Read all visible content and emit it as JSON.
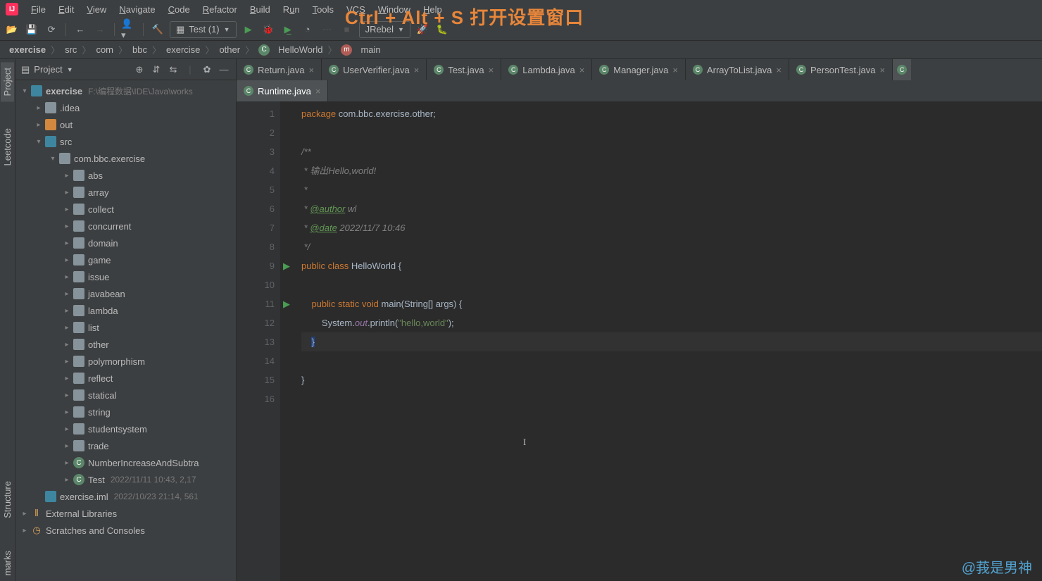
{
  "overlay_hint": "Ctrl + Alt + S 打开设置窗口",
  "menu": [
    "File",
    "Edit",
    "View",
    "Navigate",
    "Code",
    "Refactor",
    "Build",
    "Run",
    "Tools",
    "VCS",
    "Window",
    "Help"
  ],
  "toolbar": {
    "run_config": "Test (1)",
    "jrebel": "JRebel"
  },
  "breadcrumbs": [
    "exercise",
    "src",
    "com",
    "bbc",
    "exercise",
    "other",
    "HelloWorld",
    "main"
  ],
  "project_panel": {
    "title": "Project",
    "root": {
      "name": "exercise",
      "path": "F:\\编程数据\\IDE\\Java\\works"
    },
    "items": [
      {
        "level": 1,
        "exp": ">",
        "icon": "folder",
        "label": ".idea"
      },
      {
        "level": 1,
        "exp": ">",
        "icon": "folder-orange",
        "label": "out"
      },
      {
        "level": 1,
        "exp": "v",
        "icon": "folder-blue",
        "label": "src"
      },
      {
        "level": 2,
        "exp": "v",
        "icon": "folder",
        "label": "com.bbc.exercise"
      },
      {
        "level": 3,
        "exp": ">",
        "icon": "folder",
        "label": "abs"
      },
      {
        "level": 3,
        "exp": ">",
        "icon": "folder",
        "label": "array"
      },
      {
        "level": 3,
        "exp": ">",
        "icon": "folder",
        "label": "collect"
      },
      {
        "level": 3,
        "exp": ">",
        "icon": "folder",
        "label": "concurrent"
      },
      {
        "level": 3,
        "exp": ">",
        "icon": "folder",
        "label": "domain"
      },
      {
        "level": 3,
        "exp": ">",
        "icon": "folder",
        "label": "game"
      },
      {
        "level": 3,
        "exp": ">",
        "icon": "folder",
        "label": "issue"
      },
      {
        "level": 3,
        "exp": ">",
        "icon": "folder",
        "label": "javabean"
      },
      {
        "level": 3,
        "exp": ">",
        "icon": "folder",
        "label": "lambda"
      },
      {
        "level": 3,
        "exp": ">",
        "icon": "folder",
        "label": "list"
      },
      {
        "level": 3,
        "exp": ">",
        "icon": "folder",
        "label": "other"
      },
      {
        "level": 3,
        "exp": ">",
        "icon": "folder",
        "label": "polymorphism"
      },
      {
        "level": 3,
        "exp": ">",
        "icon": "folder",
        "label": "reflect"
      },
      {
        "level": 3,
        "exp": ">",
        "icon": "folder",
        "label": "statical"
      },
      {
        "level": 3,
        "exp": ">",
        "icon": "folder",
        "label": "string"
      },
      {
        "level": 3,
        "exp": ">",
        "icon": "folder",
        "label": "studentsystem"
      },
      {
        "level": 3,
        "exp": ">",
        "icon": "folder",
        "label": "trade"
      },
      {
        "level": 3,
        "exp": ">",
        "icon": "java-c",
        "label": "NumberIncreaseAndSubtra"
      },
      {
        "level": 3,
        "exp": ">",
        "icon": "java-c",
        "label": "Test",
        "meta": "2022/11/11 10:43, 2,17"
      },
      {
        "level": 1,
        "exp": "",
        "icon": "module",
        "label": "exercise.iml",
        "meta": "2022/10/23 21:14, 561"
      }
    ],
    "external": "External Libraries",
    "scratches": "Scratches and Consoles"
  },
  "tabs_row1": [
    {
      "label": "Return.java"
    },
    {
      "label": "UserVerifier.java"
    },
    {
      "label": "Test.java"
    },
    {
      "label": "Lambda.java"
    },
    {
      "label": "Manager.java"
    },
    {
      "label": "ArrayToList.java"
    },
    {
      "label": "PersonTest.java"
    }
  ],
  "tabs_row2": [
    {
      "label": "Runtime.java",
      "active": true
    }
  ],
  "code": {
    "lines": [
      "1",
      "2",
      "3",
      "4",
      "5",
      "6",
      "7",
      "8",
      "9",
      "10",
      "11",
      "12",
      "13",
      "14",
      "15",
      "16"
    ],
    "pkg": "package ",
    "pkg_name": "com.bbc.exercise.other",
    "doc_open": "/**",
    "doc_l1": " * 输出Hello,world!",
    "doc_l2": " *",
    "doc_author_tag": "@author",
    "doc_author": " wl",
    "doc_date_tag": "@date",
    "doc_date": " 2022/11/7 10:46",
    "doc_close": " */",
    "class_kw": "public class ",
    "class_name": "HelloWorld ",
    "brace_open": "{",
    "main_sig_kw": "public static void ",
    "main_name": "main",
    "main_params": "(String[] args) ",
    "main_brace": "{",
    "println_pre": "System.",
    "println_out": "out",
    "println_call": ".println(",
    "println_str": "\"hello,world\"",
    "println_end": ");",
    "brace_close_inner": "}",
    "brace_close_outer": "}"
  },
  "left_tabs": [
    "Project",
    "Leetcode",
    "Structure",
    "marks"
  ],
  "watermark": "@莪是男神"
}
